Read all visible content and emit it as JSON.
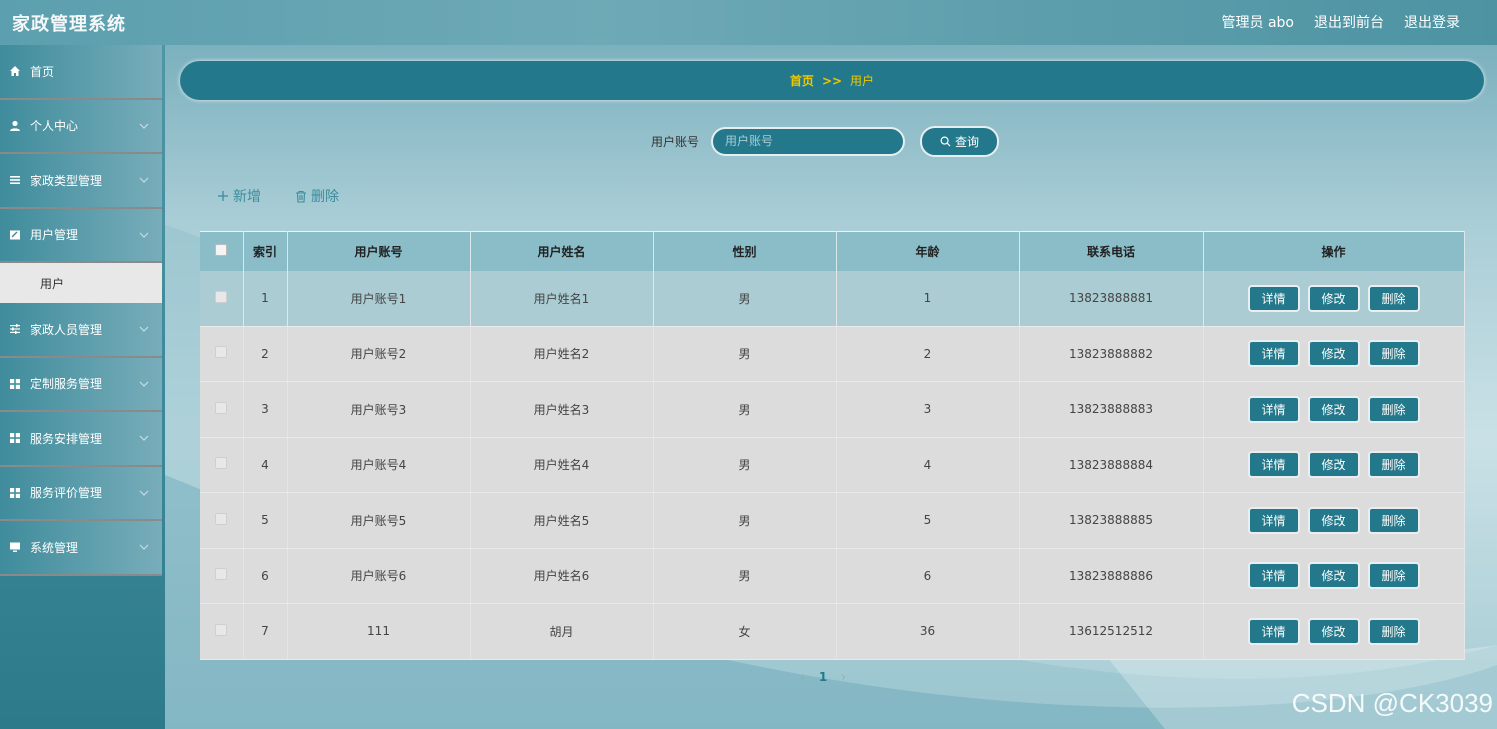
{
  "header": {
    "title": "家政管理系统",
    "admin_label": "管理员 abo",
    "back_to_front": "退出到前台",
    "logout": "退出登录"
  },
  "sidebar": {
    "items": [
      {
        "label": "首页",
        "icon": "home-icon"
      },
      {
        "label": "个人中心",
        "icon": "user-icon"
      },
      {
        "label": "家政类型管理",
        "icon": "list-icon"
      },
      {
        "label": "用户管理",
        "icon": "edit-icon",
        "expanded": true,
        "children": [
          {
            "label": "用户"
          }
        ]
      },
      {
        "label": "家政人员管理",
        "icon": "sliders-icon"
      },
      {
        "label": "定制服务管理",
        "icon": "grid-icon"
      },
      {
        "label": "服务安排管理",
        "icon": "grid-icon"
      },
      {
        "label": "服务评价管理",
        "icon": "grid-icon"
      },
      {
        "label": "系统管理",
        "icon": "monitor-icon"
      }
    ]
  },
  "breadcrumb": {
    "home": "首页",
    "separator": ">>",
    "current": "用户"
  },
  "search": {
    "label": "用户账号",
    "placeholder": "用户账号",
    "value": "",
    "button": "查询"
  },
  "actions": {
    "add": "新增",
    "delete": "删除"
  },
  "table": {
    "headers": [
      "索引",
      "用户账号",
      "用户姓名",
      "性别",
      "年龄",
      "联系电话",
      "操作"
    ],
    "rows": [
      {
        "index": "1",
        "account": "用户账号1",
        "name": "用户姓名1",
        "gender": "男",
        "age": "1",
        "phone": "13823888881"
      },
      {
        "index": "2",
        "account": "用户账号2",
        "name": "用户姓名2",
        "gender": "男",
        "age": "2",
        "phone": "13823888882"
      },
      {
        "index": "3",
        "account": "用户账号3",
        "name": "用户姓名3",
        "gender": "男",
        "age": "3",
        "phone": "13823888883"
      },
      {
        "index": "4",
        "account": "用户账号4",
        "name": "用户姓名4",
        "gender": "男",
        "age": "4",
        "phone": "13823888884"
      },
      {
        "index": "5",
        "account": "用户账号5",
        "name": "用户姓名5",
        "gender": "男",
        "age": "5",
        "phone": "13823888885"
      },
      {
        "index": "6",
        "account": "用户账号6",
        "name": "用户姓名6",
        "gender": "男",
        "age": "6",
        "phone": "13823888886"
      },
      {
        "index": "7",
        "account": "111",
        "name": "胡月",
        "gender": "女",
        "age": "36",
        "phone": "13612512512"
      }
    ],
    "row_buttons": {
      "detail": "详情",
      "edit": "修改",
      "delete": "删除"
    }
  },
  "pagination": {
    "current_page": "1"
  },
  "watermark": "CSDN @CK3039",
  "colors": {
    "primary": "#23798b",
    "breadcrumb_text": "#f0c800",
    "header_bg": "#5c9fae",
    "table_header_bg": "#8bbdc9",
    "row_bg": "#dcdcdc"
  }
}
